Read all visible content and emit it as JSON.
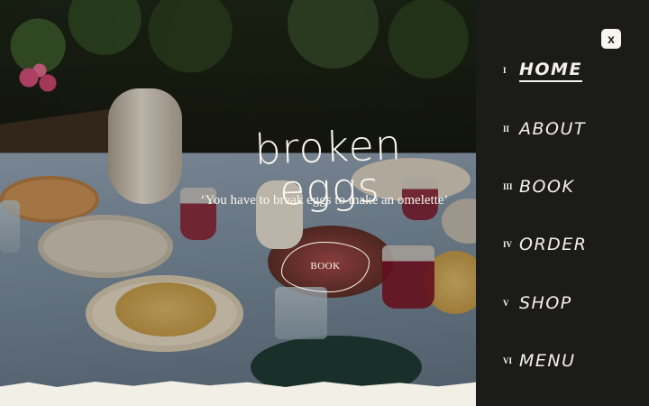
{
  "hero": {
    "brand_title": "broken eggs",
    "tagline": "‘You have to break eggs to make an omelette’",
    "book_button_label": "BOOK",
    "image": "outdoor-table-spread-photo"
  },
  "sidebar": {
    "close_label": "x",
    "items": [
      {
        "numeral": "I",
        "label": "HOME",
        "active": true
      },
      {
        "numeral": "II",
        "label": "ABOUT",
        "active": false
      },
      {
        "numeral": "III",
        "label": "BOOK",
        "active": false
      },
      {
        "numeral": "IV",
        "label": "ORDER",
        "active": false
      },
      {
        "numeral": "V",
        "label": "SHOP",
        "active": false
      },
      {
        "numeral": "VI",
        "label": "MENU",
        "active": false
      }
    ]
  },
  "colors": {
    "sidebar_bg": "#1b1b1a",
    "text_light": "#f4f1ea",
    "paper": "#f2efe6"
  }
}
